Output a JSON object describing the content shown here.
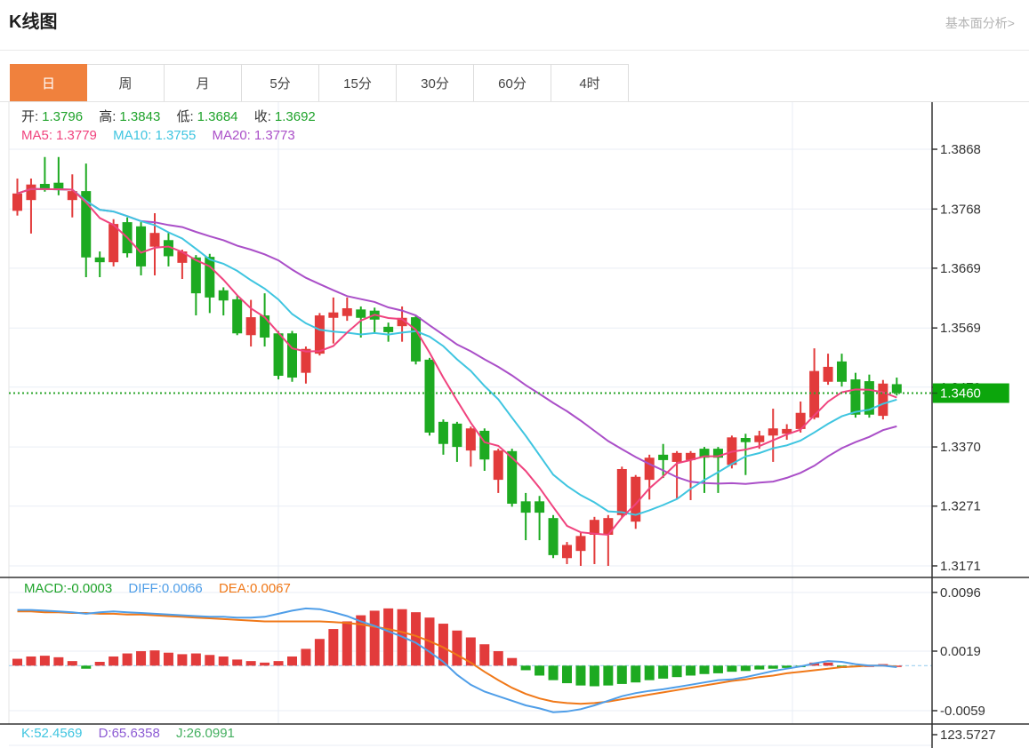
{
  "header": {
    "title": "K线图",
    "link_label": "基本面分析>"
  },
  "tabs": {
    "active": "日",
    "items": [
      "日",
      "周",
      "月",
      "5分",
      "15分",
      "30分",
      "60分",
      "4时"
    ]
  },
  "info_bar": {
    "open_label": "开:",
    "open": "1.3796",
    "high_label": "高:",
    "high": "1.3843",
    "low_label": "低:",
    "low": "1.3684",
    "close_label": "收:",
    "close": "1.3692"
  },
  "ma_bar": {
    "ma5_label": "MA5:",
    "ma5": "1.3779",
    "ma10_label": "MA10:",
    "ma10": "1.3755",
    "ma20_label": "MA20:",
    "ma20": "1.3773"
  },
  "macd_bar": {
    "macd_label": "MACD:",
    "macd": "-0.0003",
    "diff_label": "DIFF:",
    "diff": "0.0066",
    "dea_label": "DEA:",
    "dea": "0.0067"
  },
  "kdj_bar": {
    "k_label": "K:",
    "k": "52.4569",
    "d_label": "D:",
    "d": "65.6358",
    "j_label": "J:",
    "j": "26.0991"
  },
  "colors": {
    "up": "#e23b3b",
    "down": "#1daa21",
    "ma5": "#f0437e",
    "ma10": "#3fc5e0",
    "ma20": "#aa4fc8",
    "diff": "#4f9ee8",
    "dea": "#f07818",
    "price_line": "#2aa52a",
    "badge_bg": "#0ca60c",
    "badge_text": "#ffffff",
    "grid": "#e9eef5",
    "axis": "#333333",
    "axis_text": "#333333",
    "macd_zero_dash": "#9fd0f0",
    "tab_active": "#f0813d",
    "link": "#b3b3b3"
  },
  "chart_data": {
    "type": "candlestick",
    "panes": [
      "price-with-ma",
      "macd",
      "kdj-partial"
    ],
    "price_axis_ticks": [
      "1.3868",
      "1.3768",
      "1.3669",
      "1.3569",
      "1.3470",
      "1.3370",
      "1.3271",
      "1.3171"
    ],
    "hidden_tick": "1.3470",
    "current_price": "1.3460",
    "macd_axis_ticks": [
      "0.0096",
      "0.0019",
      "-0.0059"
    ],
    "kdj_axis_tick": "123.5727",
    "ma_periods": [
      5,
      10,
      20
    ],
    "price_range": [
      1.3868,
      1.3171
    ],
    "macd_range": [
      0.011,
      -0.0108
    ],
    "candles": [
      [
        1.3765,
        1.3819,
        1.3757,
        1.3794
      ],
      [
        1.3783,
        1.3819,
        1.3727,
        1.3809
      ],
      [
        1.381,
        1.3855,
        1.3797,
        1.3801
      ],
      [
        1.3812,
        1.3855,
        1.3791,
        1.38
      ],
      [
        1.3783,
        1.3826,
        1.3754,
        1.3798
      ],
      [
        1.3798,
        1.3844,
        1.3654,
        1.3687
      ],
      [
        1.3687,
        1.3697,
        1.3654,
        1.3679
      ],
      [
        1.3679,
        1.3751,
        1.3672,
        1.3743
      ],
      [
        1.3746,
        1.3754,
        1.3687,
        1.3694
      ],
      [
        1.3739,
        1.3746,
        1.3657,
        1.3672
      ],
      [
        1.3705,
        1.3761,
        1.3657,
        1.3728
      ],
      [
        1.3716,
        1.3728,
        1.3672,
        1.3689
      ],
      [
        1.3678,
        1.37,
        1.3651,
        1.3697
      ],
      [
        1.3687,
        1.3691,
        1.359,
        1.3627
      ],
      [
        1.3688,
        1.3693,
        1.3594,
        1.362
      ],
      [
        1.3632,
        1.3637,
        1.359,
        1.3615
      ],
      [
        1.3617,
        1.3623,
        1.3557,
        1.356
      ],
      [
        1.3557,
        1.3616,
        1.3538,
        1.3587
      ],
      [
        1.359,
        1.3627,
        1.3538,
        1.3553
      ],
      [
        1.356,
        1.3564,
        1.3483,
        1.3489
      ],
      [
        1.356,
        1.3564,
        1.3479,
        1.3486
      ],
      [
        1.3494,
        1.3538,
        1.3476,
        1.3534
      ],
      [
        1.3526,
        1.3594,
        1.3523,
        1.359
      ],
      [
        1.3586,
        1.362,
        1.3543,
        1.3595
      ],
      [
        1.3589,
        1.362,
        1.3581,
        1.3602
      ],
      [
        1.36,
        1.3605,
        1.3553,
        1.3586
      ],
      [
        1.3598,
        1.3603,
        1.356,
        1.3583
      ],
      [
        1.3571,
        1.3578,
        1.3546,
        1.3562
      ],
      [
        1.3572,
        1.3605,
        1.3546,
        1.3586
      ],
      [
        1.3587,
        1.359,
        1.3508,
        1.3513
      ],
      [
        1.3516,
        1.3519,
        1.3389,
        1.3394
      ],
      [
        1.3412,
        1.3416,
        1.3357,
        1.3375
      ],
      [
        1.3409,
        1.3412,
        1.3345,
        1.337
      ],
      [
        1.3364,
        1.3404,
        1.3337,
        1.3401
      ],
      [
        1.3397,
        1.3401,
        1.333,
        1.3349
      ],
      [
        1.3315,
        1.3367,
        1.3293,
        1.3364
      ],
      [
        1.3363,
        1.3367,
        1.327,
        1.3275
      ],
      [
        1.3279,
        1.3293,
        1.3214,
        1.326
      ],
      [
        1.3279,
        1.3288,
        1.3214,
        1.326
      ],
      [
        1.3251,
        1.3256,
        1.3184,
        1.3189
      ],
      [
        1.3184,
        1.3211,
        1.3174,
        1.3206
      ],
      [
        1.3196,
        1.3226,
        1.3171,
        1.3221
      ],
      [
        1.3223,
        1.3253,
        1.3174,
        1.3248
      ],
      [
        1.3223,
        1.3256,
        1.3171,
        1.3251
      ],
      [
        1.3256,
        1.3337,
        1.3251,
        1.3333
      ],
      [
        1.3245,
        1.3323,
        1.3233,
        1.332
      ],
      [
        1.3315,
        1.3357,
        1.3282,
        1.3352
      ],
      [
        1.3357,
        1.3375,
        1.3318,
        1.3348
      ],
      [
        1.3345,
        1.3363,
        1.3282,
        1.336
      ],
      [
        1.3348,
        1.3363,
        1.3281,
        1.336
      ],
      [
        1.3367,
        1.337,
        1.3293,
        1.3352
      ],
      [
        1.3367,
        1.337,
        1.3293,
        1.3352
      ],
      [
        1.334,
        1.3389,
        1.3334,
        1.3386
      ],
      [
        1.3385,
        1.3392,
        1.3323,
        1.3378
      ],
      [
        1.3378,
        1.3397,
        1.3367,
        1.3389
      ],
      [
        1.3389,
        1.3434,
        1.3345,
        1.3401
      ],
      [
        1.3392,
        1.3408,
        1.3382,
        1.34
      ],
      [
        1.34,
        1.3446,
        1.3394,
        1.3427
      ],
      [
        1.3419,
        1.3535,
        1.3416,
        1.3497
      ],
      [
        1.3479,
        1.3526,
        1.3474,
        1.3504
      ],
      [
        1.3513,
        1.3526,
        1.3471,
        1.3479
      ],
      [
        1.3483,
        1.3494,
        1.3419,
        1.3424
      ],
      [
        1.348,
        1.3491,
        1.3419,
        1.3424
      ],
      [
        1.3422,
        1.3482,
        1.3416,
        1.3476
      ],
      [
        1.3475,
        1.3486,
        1.3456,
        1.346
      ]
    ],
    "macd": {
      "diff": [
        0.0073,
        0.0073,
        0.0072,
        0.0071,
        0.007,
        0.0068,
        0.007,
        0.0071,
        0.007,
        0.0069,
        0.0068,
        0.0067,
        0.0066,
        0.0065,
        0.0064,
        0.0064,
        0.0063,
        0.0063,
        0.0064,
        0.0068,
        0.0072,
        0.0075,
        0.0074,
        0.007,
        0.0065,
        0.0058,
        0.0052,
        0.0045,
        0.0038,
        0.003,
        0.0018,
        0.0005,
        -0.0012,
        -0.0025,
        -0.0034,
        -0.004,
        -0.0046,
        -0.0052,
        -0.0056,
        -0.0061,
        -0.006,
        -0.0057,
        -0.0052,
        -0.0046,
        -0.004,
        -0.0036,
        -0.0033,
        -0.0031,
        -0.0028,
        -0.0025,
        -0.0022,
        -0.0019,
        -0.0018,
        -0.0015,
        -0.0011,
        -0.0007,
        -0.0004,
        -0.0001,
        0.0003,
        0.0006,
        0.0005,
        0.0002,
        0.0,
        0.0,
        -0.0002
      ],
      "dea": [
        0.0071,
        0.0071,
        0.007,
        0.007,
        0.0069,
        0.0069,
        0.0068,
        0.0068,
        0.0067,
        0.0067,
        0.0066,
        0.0065,
        0.0064,
        0.0063,
        0.0062,
        0.0061,
        0.006,
        0.0059,
        0.0058,
        0.0058,
        0.0058,
        0.0058,
        0.0058,
        0.0057,
        0.0056,
        0.0054,
        0.0051,
        0.0048,
        0.0044,
        0.0039,
        0.0032,
        0.0024,
        0.0014,
        0.0004,
        -0.0008,
        -0.0019,
        -0.0029,
        -0.0037,
        -0.0043,
        -0.0047,
        -0.0049,
        -0.005,
        -0.0049,
        -0.0047,
        -0.0044,
        -0.0041,
        -0.0038,
        -0.0035,
        -0.0032,
        -0.0029,
        -0.0026,
        -0.0023,
        -0.002,
        -0.0018,
        -0.0015,
        -0.0013,
        -0.001,
        -0.0008,
        -0.0006,
        -0.0004,
        -0.0002,
        -0.0001,
        0.0,
        0.0,
        -0.0001
      ],
      "hist": [
        0.0009,
        0.0012,
        0.0013,
        0.0011,
        0.0006,
        -0.0004,
        0.0005,
        0.0012,
        0.0016,
        0.0019,
        0.002,
        0.0017,
        0.0015,
        0.0016,
        0.0014,
        0.0012,
        0.0008,
        0.0006,
        0.0004,
        0.0006,
        0.0012,
        0.0022,
        0.0035,
        0.0048,
        0.0058,
        0.0066,
        0.0072,
        0.0075,
        0.0074,
        0.007,
        0.0063,
        0.0055,
        0.0046,
        0.0037,
        0.0028,
        0.0019,
        0.001,
        -0.0006,
        -0.0013,
        -0.0019,
        -0.0023,
        -0.0026,
        -0.0027,
        -0.0026,
        -0.0024,
        -0.0022,
        -0.0019,
        -0.0017,
        -0.0015,
        -0.0013,
        -0.0011,
        -0.001,
        -0.0008,
        -0.0007,
        -0.0005,
        -0.0004,
        -0.0003,
        -0.0002,
        0.0004,
        0.0004,
        -0.0003,
        -0.0002,
        0.0,
        0.0002,
        0.0
      ]
    }
  }
}
